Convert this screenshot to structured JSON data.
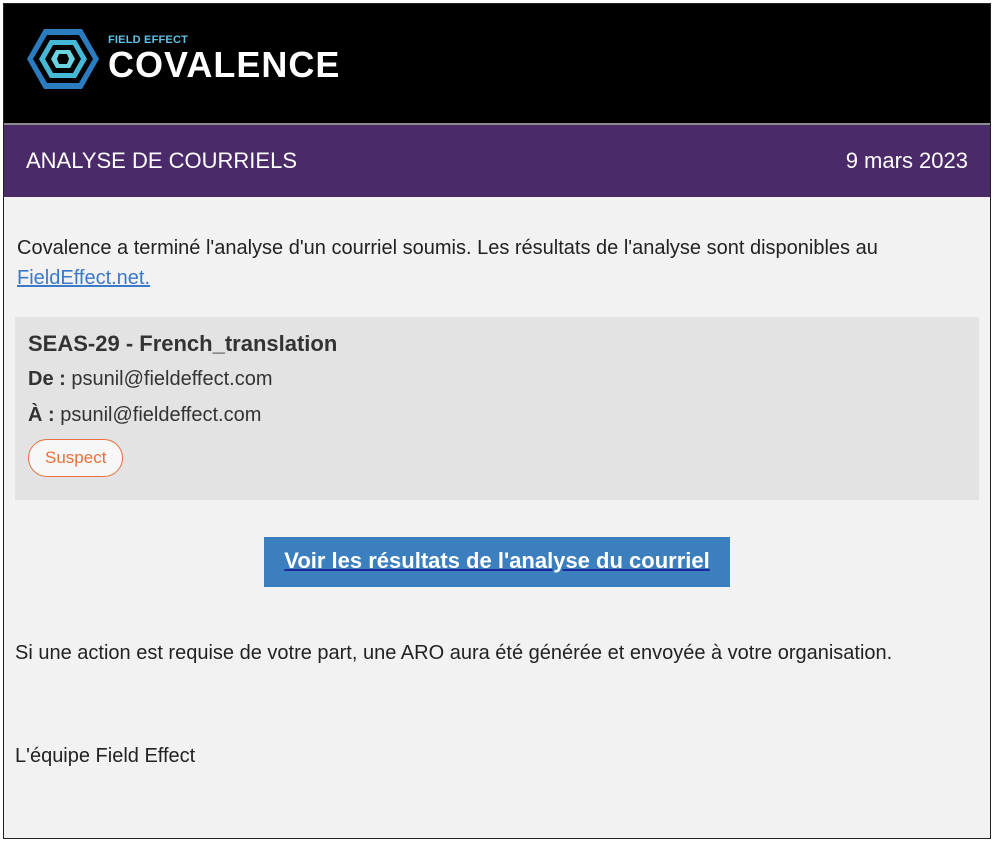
{
  "logo": {
    "sub": "FIELD EFFECT",
    "main": "COVALENCE"
  },
  "header": {
    "title": "ANALYSE DE COURRIELS",
    "date": "9 mars 2023"
  },
  "intro": {
    "text": "Covalence a terminé l'analyse d'un courriel soumis. Les résultats de l'analyse sont disponibles au ",
    "link": "FieldEffect.net."
  },
  "card": {
    "title": "SEAS-29 - French_translation",
    "from_label": "De :",
    "from_value": "psunil@fieldeffect.com",
    "to_label": "À :",
    "to_value": "psunil@fieldeffect.com",
    "status": "Suspect"
  },
  "cta": {
    "label": "Voir les résultats de l'analyse du courriel"
  },
  "outro": {
    "text": "Si une action est requise de votre part, une ARO aura été générée et envoyée à votre organisation."
  },
  "signature": {
    "text": "L'équipe Field Effect"
  },
  "colors": {
    "header_bg": "#000000",
    "title_bar": "#4b2a6a",
    "cta_bg": "#3c7fbe",
    "badge": "#e8703a",
    "link": "#3b79c9"
  }
}
